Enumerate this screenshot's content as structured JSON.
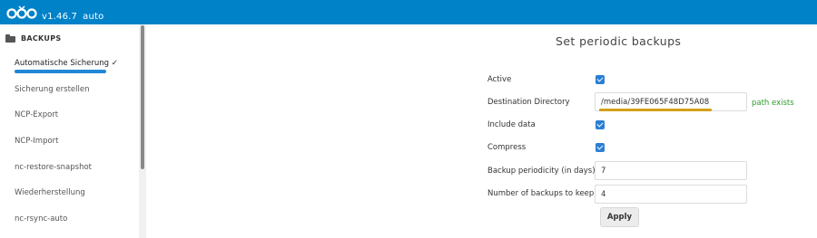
{
  "header": {
    "logo_icon": "nextcloudpi-logo-icon",
    "version": "v1.46.7",
    "mode": "auto",
    "color": "#0082c9"
  },
  "sidebar": {
    "section_label": "BACKUPS",
    "section_icon": "folder-icon",
    "items": [
      {
        "label": "Automatische Sicherung ✓",
        "active": true
      },
      {
        "label": "Sicherung erstellen",
        "active": false
      },
      {
        "label": "NCP-Export",
        "active": false
      },
      {
        "label": "NCP-Import",
        "active": false
      },
      {
        "label": "nc-restore-snapshot",
        "active": false
      },
      {
        "label": "Wiederherstellung",
        "active": false
      },
      {
        "label": "nc-rsync-auto",
        "active": false
      }
    ]
  },
  "form": {
    "title": "Set periodic backups",
    "active_label": "Active",
    "active_checked": true,
    "destination_label": "Destination Directory",
    "destination_value": "/media/39FE065F48D75A08",
    "destination_status": "path exists",
    "include_data_label": "Include data",
    "include_data_checked": true,
    "compress_label": "Compress",
    "compress_checked": true,
    "periodicity_label": "Backup periodicity (in days)",
    "periodicity_value": "7",
    "keep_label": "Number of backups to keep",
    "keep_value": "4",
    "apply_label": "Apply"
  }
}
